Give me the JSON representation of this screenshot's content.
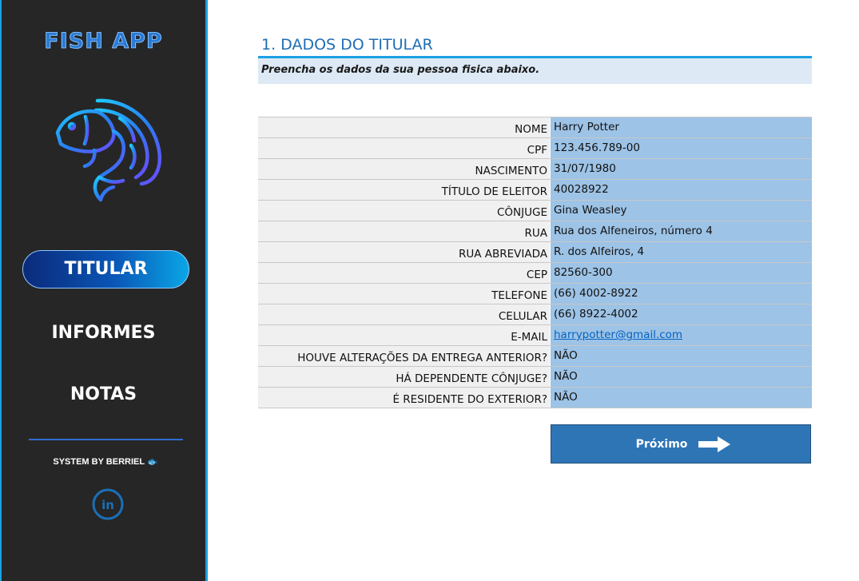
{
  "sidebar": {
    "app_title": "FISH APP",
    "nav": {
      "titular": "TITULAR",
      "informes": "INFORMES",
      "notas": "NOTAS"
    },
    "credit": "SYSTEM BY BERRIEL",
    "credit_icon": "🐟",
    "linkedin_label": "in"
  },
  "main": {
    "section_title": "1. DADOS DO TITULAR",
    "subtitle": "Preencha os dados da sua pessoa fisica abaixo.",
    "fields": [
      {
        "label": "NOME",
        "value": "Harry Potter"
      },
      {
        "label": "CPF",
        "value": "123.456.789-00"
      },
      {
        "label": "NASCIMENTO",
        "value": "31/07/1980"
      },
      {
        "label": "TÍTULO DE ELEITOR",
        "value": "40028922"
      },
      {
        "label": "CÔNJUGE",
        "value": "Gina Weasley"
      },
      {
        "label": "RUA",
        "value": "Rua dos Alfeneiros, número 4"
      },
      {
        "label": "RUA ABREVIADA",
        "value": "R. dos Alfeiros, 4"
      },
      {
        "label": "CEP",
        "value": "82560-300"
      },
      {
        "label": "TELEFONE",
        "value": "(66) 4002-8922"
      },
      {
        "label": "CELULAR",
        "value": "(66) 8922-4002"
      },
      {
        "label": "E-MAIL",
        "value": "harrypotter@gmail.com"
      },
      {
        "label": "HOUVE ALTERAÇÕES DA ENTREGA ANTERIOR?",
        "value": "NÃO"
      },
      {
        "label": "HÁ DEPENDENTE CÔNJUGE?",
        "value": "NÃO"
      },
      {
        "label": "É RESIDENTE DO EXTERIOR?",
        "value": "NÃO"
      }
    ],
    "next_button": "Próximo"
  },
  "colors": {
    "sidebar_bg": "#262626",
    "accent": "#1ba1e2",
    "title_blue": "#1f6db5",
    "value_cell": "#9dc3e6",
    "label_cell": "#f0f0f0",
    "button_blue": "#2e75b6"
  },
  "icons": {
    "logo": "fish-icon",
    "next": "arrow-right-icon",
    "social": "linkedin-icon"
  }
}
